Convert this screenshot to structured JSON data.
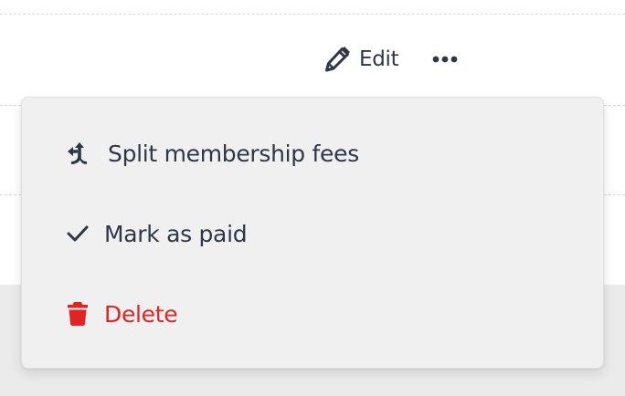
{
  "toolbar": {
    "edit_label": "Edit",
    "edit_icon": "pencil-icon",
    "more_icon": "ellipsis-horizontal-icon"
  },
  "menu": {
    "items": [
      {
        "label": "Split membership fees",
        "icon": "split-arrows-icon"
      },
      {
        "label": "Mark as paid",
        "icon": "check-icon"
      },
      {
        "label": "Delete",
        "icon": "trash-icon",
        "color": "#e02424"
      }
    ]
  },
  "colors": {
    "text": "#2d3748",
    "danger": "#e02424",
    "menu_background": "#f0f0f0",
    "page_background": "#ebebeb"
  }
}
